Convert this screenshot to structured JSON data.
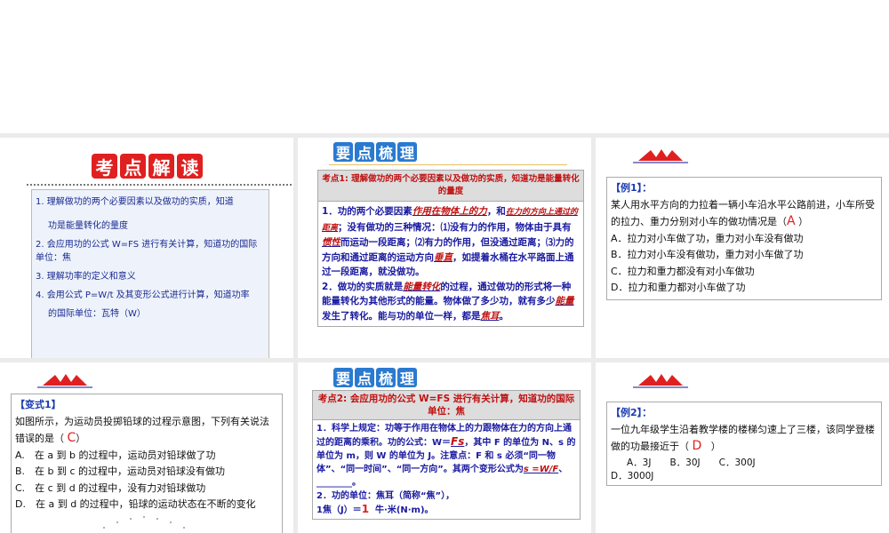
{
  "slide1": {
    "title": [
      "考",
      "点",
      "解",
      "读"
    ],
    "items": [
      "1. 理解做功的两个必要因素以及做功的实质，知道",
      "功是能量转化的量度",
      "2. 会应用功的公式 W=FS 进行有关计算，知道功的国际单位：焦",
      "3. 理解功率的定义和意义",
      "4. 会用公式 P=W/t 及其变形公式进行计算，知道功率",
      "的国际单位：瓦特（W）"
    ]
  },
  "slide2": {
    "title": [
      "要",
      "点",
      "梳",
      "理"
    ],
    "header": "考点1: 理解做功的两个必要因素以及做功的实质，知道功是能量转化的量度",
    "p1a": "1．功的两个必要因素",
    "ans1": "作用在物体上的力",
    "p1b": "，和",
    "ans2": "在力的方向上通过的距离",
    "p1c": "；没有做功的三种情况：⑴没有力的作用，物体由于具有",
    "ans3": "惯性",
    "p1d": "而运动一段距离；⑵有力的作用，但没通过距离；⑶力的方向和通过距离的运动方向",
    "ans4": "垂直",
    "p1e": "，如提着水桶在水平路面上通过一段距离，就没做功。",
    "p2a": "2．做功的实质就是",
    "ans5": "能量转化",
    "p2b": "的过程，通过做功的形式将一种能量转化为其他形式的能量。物体做了多少功，就有多少",
    "ans6": "能量",
    "p2c": "发生了转化。能与功的单位一样，都是",
    "ans7": "焦耳",
    "p2d": "。"
  },
  "slide3": {
    "tag": "【例1】：",
    "question": "某人用水平方向的力拉着一辆小车沿水平公路前进，小车所受的拉力、重力分别对小车的做功情况是（",
    "answer": "A",
    "close": "）",
    "options": [
      "A．拉力对小车做了功，重力对小车没有做功",
      "B．拉力对小车没有做功，重力对小车做了功",
      "C．拉力和重力都没有对小车做功",
      "D．拉力和重力都对小车做了功"
    ]
  },
  "slide4": {
    "tag": "【变式1】",
    "question": "如图所示，为运动员投掷铅球的过程示意图，下列有关说法错误的是（",
    "answer": "C",
    "close": "）",
    "options": [
      "A.　在 a 到 b 的过程中，运动员对铅球做了功",
      "B.　在 b 到 c 的过程中，运动员对铅球没有做功",
      "C.　在 c 到 d 的过程中，没有力对铅球做功",
      "D.　在 a 到 d 的过程中，铅球的运动状态在不断的变化"
    ]
  },
  "slide5": {
    "title": [
      "要",
      "点",
      "梳",
      "理"
    ],
    "header": "考点2: 会应用功的公式 W=FS 进行有关计算，知道功的国际单位：焦",
    "p1a": "1．科学上规定：功等于作用在物体上的力跟物体在力的方向上通过的距离的乘积。功的公式：W＝",
    "ans1": "Fs",
    "p1b": "，其中 F 的单位为 N、s 的单位为 m，则 W 的单位为 J。注意点：F 和 s 必须“同一物体”、“同一时间”、“同一方向”。其两个变形公式为",
    "ans2": "s =W/F",
    "p1c": "、________。",
    "p2": "2．功的单位：焦耳（简称“焦”），",
    "p3a": "1焦（J）＝",
    "ans3": "1",
    "p3b": "牛·米(N·m)。"
  },
  "slide6": {
    "tag": "【例2】：",
    "question": "一位九年级学生沿着教学楼的楼梯匀速上了三楼，该同学登楼做的功最接近于（",
    "answer": "D",
    "close": "）",
    "options": [
      "A．3J",
      "B．30J",
      "C．300J",
      "D．3000J"
    ]
  }
}
